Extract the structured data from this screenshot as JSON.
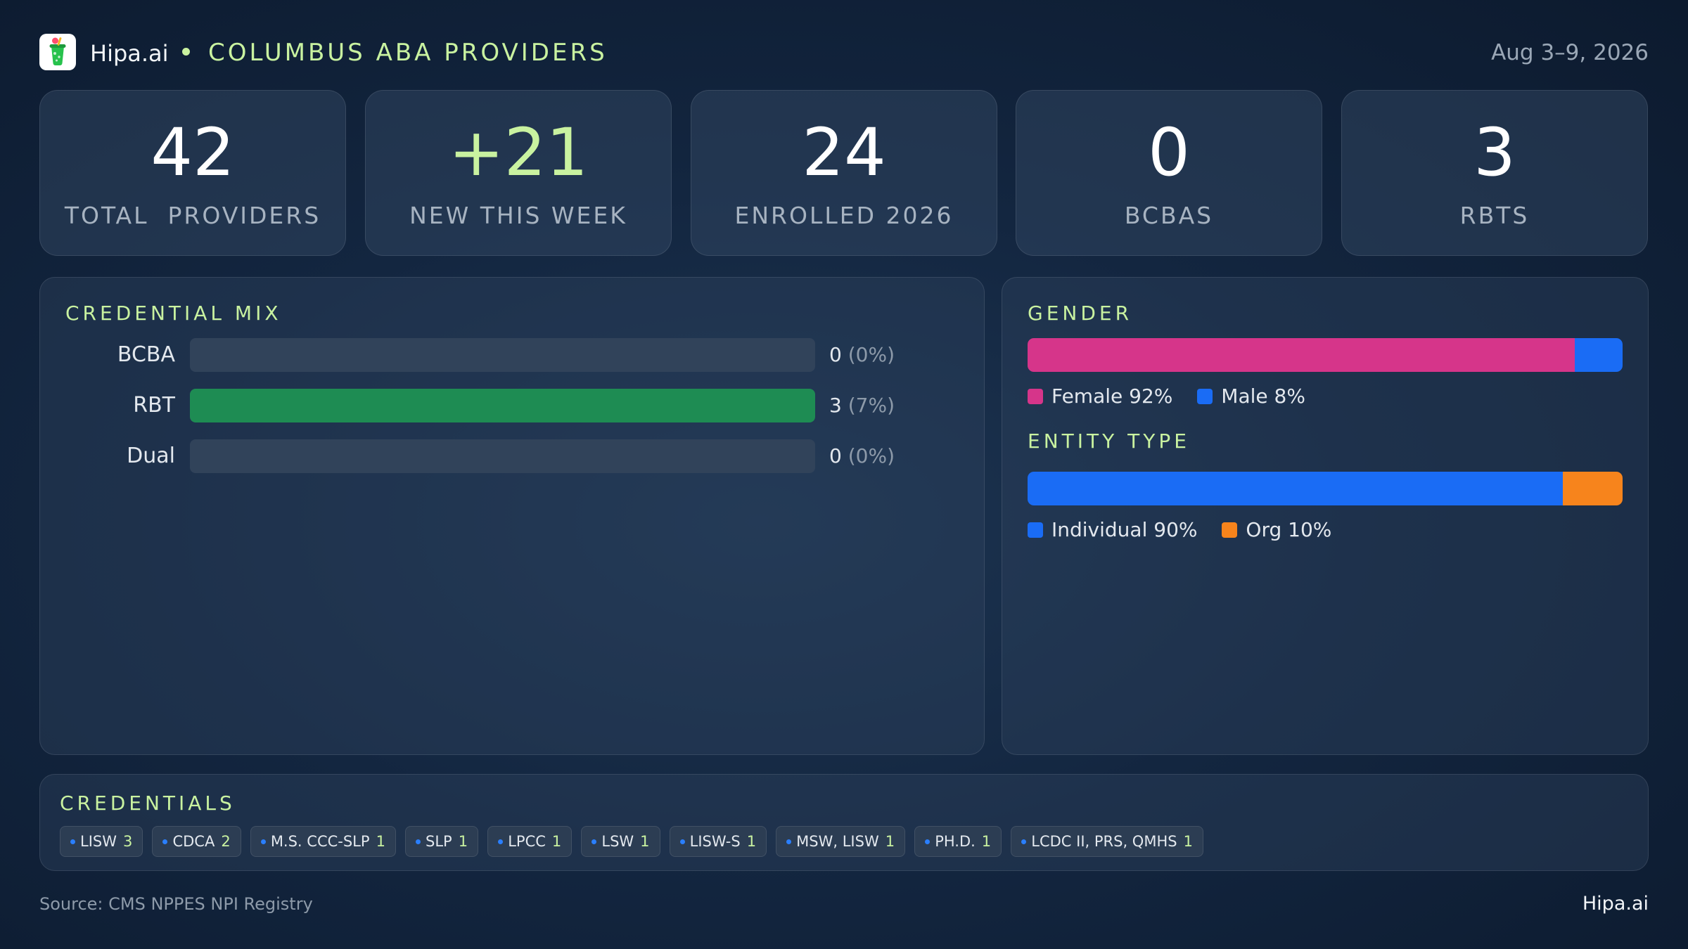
{
  "header": {
    "brand": "Hipa.ai",
    "title": "COLUMBUS ABA PROVIDERS",
    "date_range": "Aug 3–9, 2026"
  },
  "kpis": [
    {
      "value": "42",
      "label": "TOTAL  PROVIDERS"
    },
    {
      "value": "+21",
      "label": "NEW THIS WEEK"
    },
    {
      "value": "24",
      "label": "ENROLLED 2026"
    },
    {
      "value": "0",
      "label": "BCBAS"
    },
    {
      "value": "3",
      "label": "RBTS"
    }
  ],
  "panels": {
    "credential_mix_title": "CREDENTIAL MIX",
    "gender_title": "GENDER",
    "entity_title": "ENTITY TYPE",
    "credentials_title": "CREDENTIALS"
  },
  "chart_data": [
    {
      "type": "bar",
      "orientation": "horizontal",
      "title": "CREDENTIAL MIX",
      "categories": [
        "BCBA",
        "RBT",
        "Dual"
      ],
      "values": [
        0,
        3,
        0
      ],
      "value_labels": [
        "0",
        "3",
        "0"
      ],
      "percent_labels": [
        "(0%)",
        "(7%)",
        "(0%)"
      ],
      "max": 3,
      "colors": {
        "fill": "#1e8c53",
        "track": "#31435a"
      }
    },
    {
      "type": "bar",
      "stacked": true,
      "title": "GENDER",
      "series": [
        {
          "name": "Female",
          "value": 92,
          "label": "Female 92%",
          "color": "#d6358a"
        },
        {
          "name": "Male",
          "value": 8,
          "label": "Male 8%",
          "color": "#1a6cf5"
        }
      ]
    },
    {
      "type": "bar",
      "stacked": true,
      "title": "ENTITY TYPE",
      "series": [
        {
          "name": "Individual",
          "value": 90,
          "label": "Individual 90%",
          "color": "#1a6cf5"
        },
        {
          "name": "Org",
          "value": 10,
          "label": "Org 10%",
          "color": "#f7841c"
        }
      ]
    }
  ],
  "credentials": [
    {
      "label": "LISW",
      "count": "3"
    },
    {
      "label": "CDCA",
      "count": "2"
    },
    {
      "label": "M.S. CCC-SLP",
      "count": "1"
    },
    {
      "label": "SLP",
      "count": "1"
    },
    {
      "label": "LPCC",
      "count": "1"
    },
    {
      "label": "LSW",
      "count": "1"
    },
    {
      "label": "LISW-S",
      "count": "1"
    },
    {
      "label": "MSW, LISW",
      "count": "1"
    },
    {
      "label": "PH.D.",
      "count": "1"
    },
    {
      "label": "LCDC II, PRS, QMHS",
      "count": "1"
    }
  ],
  "footer": {
    "source": "Source: CMS NPPES NPI Registry",
    "brand": "Hipa.ai"
  },
  "colors": {
    "accent": "#c9f2a0"
  }
}
